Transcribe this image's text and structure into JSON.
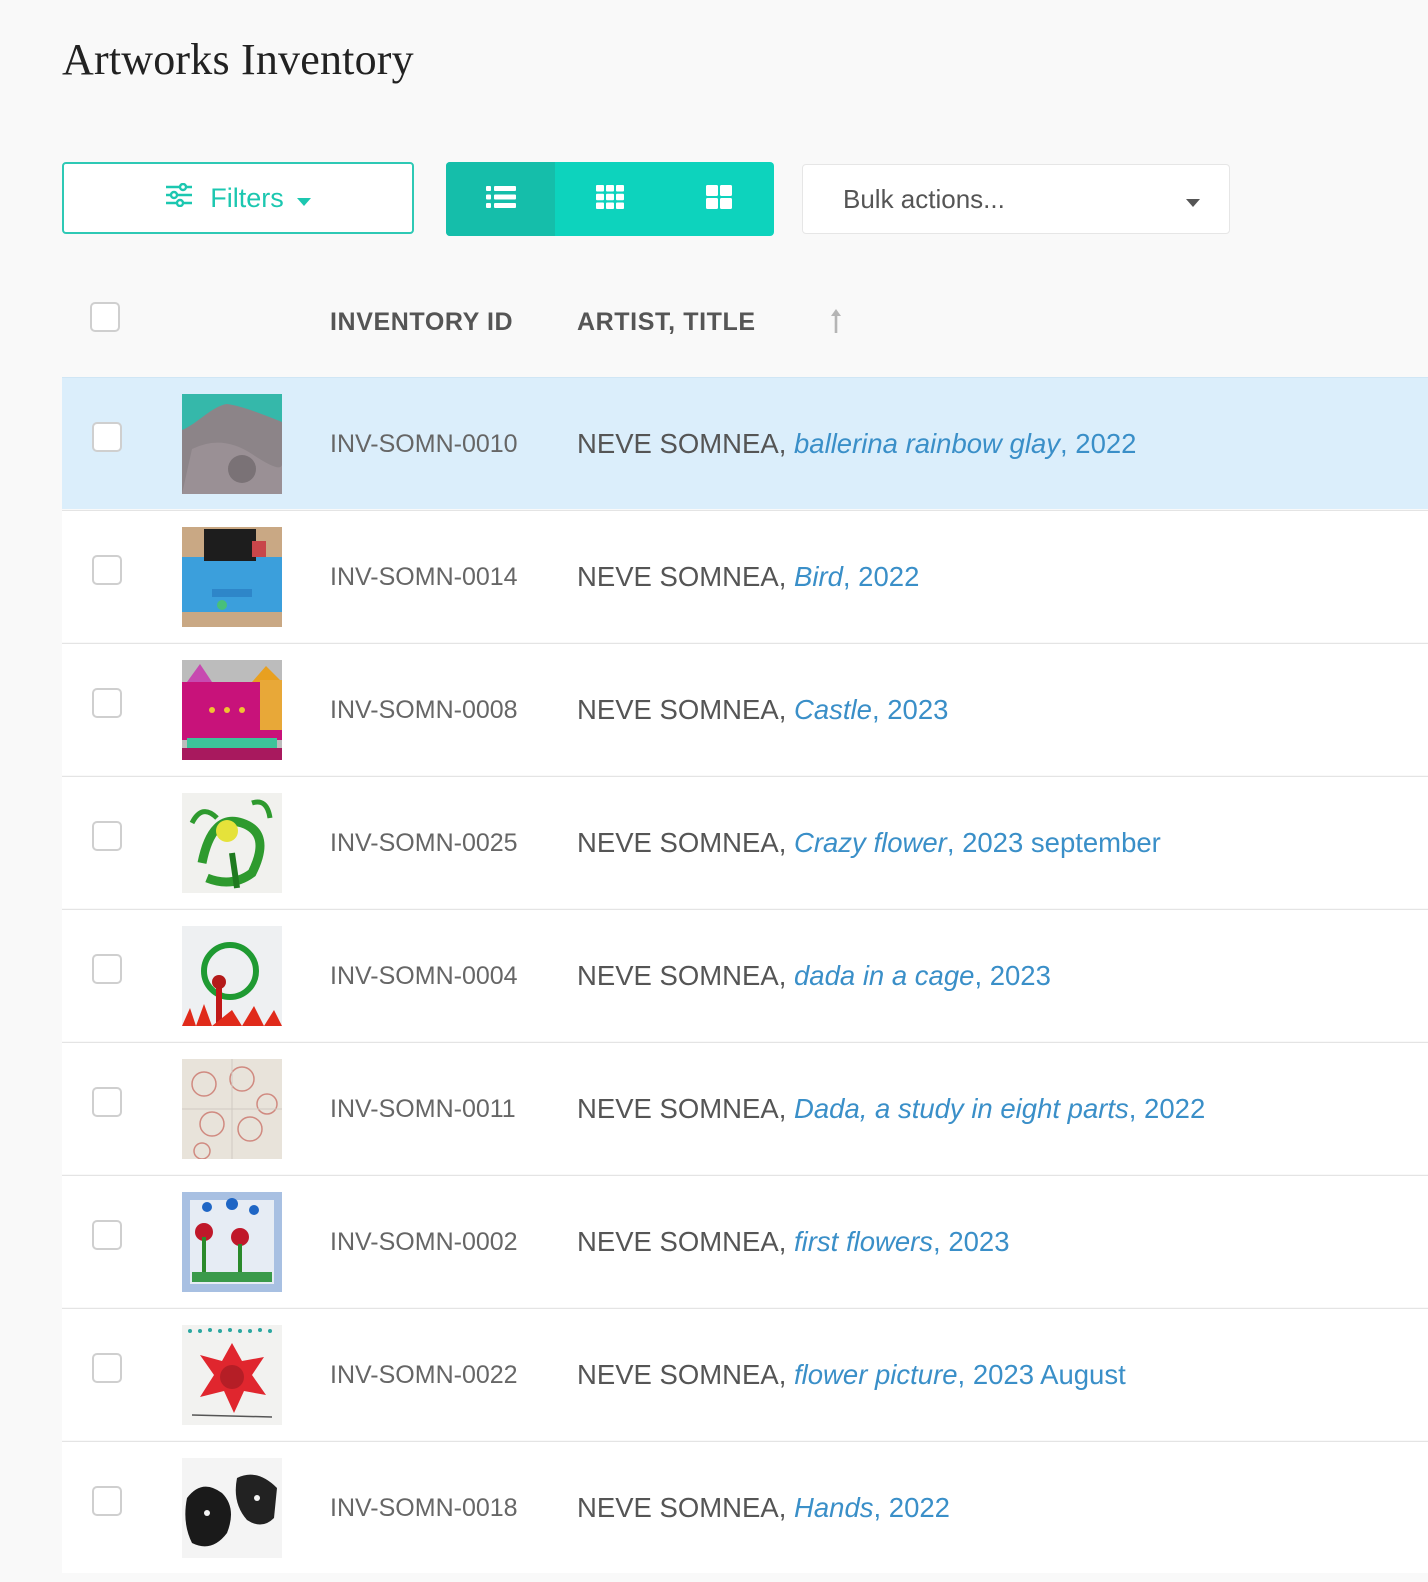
{
  "page": {
    "title": "Artworks Inventory"
  },
  "toolbar": {
    "filters_label": "Filters",
    "views": [
      {
        "name": "list",
        "icon": "list-icon",
        "active": true
      },
      {
        "name": "grid-small",
        "icon": "grid-small-icon",
        "active": false
      },
      {
        "name": "grid-large",
        "icon": "grid-large-icon",
        "active": false
      }
    ],
    "bulk_placeholder": "Bulk actions..."
  },
  "table": {
    "columns": {
      "inventory_id": "INVENTORY ID",
      "artist_title": "ARTIST, TITLE"
    },
    "sort": {
      "column": "artist_title",
      "direction": "ascending"
    },
    "rows": [
      {
        "id": "INV-SOMN-0010",
        "artist": "NEVE SOMNEA, ",
        "title": "ballerina rainbow glay",
        "year": ", 2022",
        "selected": true
      },
      {
        "id": "INV-SOMN-0014",
        "artist": "NEVE SOMNEA, ",
        "title": "Bird",
        "year": ", 2022",
        "selected": false
      },
      {
        "id": "INV-SOMN-0008",
        "artist": "NEVE SOMNEA, ",
        "title": "Castle",
        "year": ", 2023",
        "selected": false
      },
      {
        "id": "INV-SOMN-0025",
        "artist": "NEVE SOMNEA, ",
        "title": "Crazy flower",
        "year": ", 2023 september",
        "selected": false
      },
      {
        "id": "INV-SOMN-0004",
        "artist": "NEVE SOMNEA, ",
        "title": "dada in a cage",
        "year": ", 2023",
        "selected": false
      },
      {
        "id": "INV-SOMN-0011",
        "artist": "NEVE SOMNEA, ",
        "title": "Dada, a study in eight parts",
        "year": ", 2022",
        "selected": false
      },
      {
        "id": "INV-SOMN-0002",
        "artist": "NEVE SOMNEA, ",
        "title": "first flowers",
        "year": ", 2023",
        "selected": false
      },
      {
        "id": "INV-SOMN-0022",
        "artist": "NEVE SOMNEA, ",
        "title": "flower picture",
        "year": ", 2023 August",
        "selected": false
      },
      {
        "id": "INV-SOMN-0018",
        "artist": "NEVE SOMNEA, ",
        "title": "Hands",
        "year": ", 2022",
        "selected": false
      }
    ]
  },
  "colors": {
    "accent": "#0dd3bd",
    "link": "#3a8fc8",
    "selected_row": "#dbeefb"
  }
}
